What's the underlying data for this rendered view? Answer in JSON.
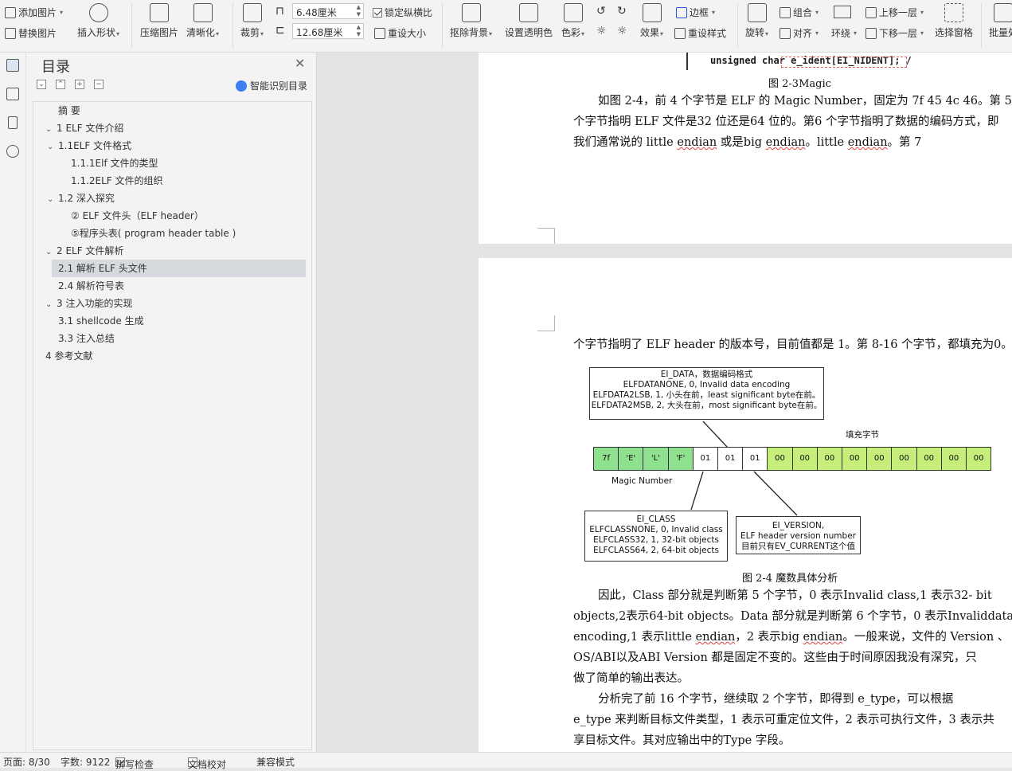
{
  "ribbon": {
    "add_image": "添加图片",
    "replace_image": "替换图片",
    "insert_shape": "插入形状",
    "compress_image": "压缩图片",
    "sharpen": "清晰化",
    "crop": "裁剪",
    "width_value": "6.48厘米",
    "height_value": "12.68厘米",
    "lock_ratio": "锁定纵横比",
    "reset_size": "重设大小",
    "remove_bg": "抠除背景",
    "set_transparent": "设置透明色",
    "color": "色彩",
    "effects": "效果",
    "border": "边框",
    "reset_style": "重设样式",
    "rotate": "旋转",
    "group": "组合",
    "align": "对齐",
    "wrap": "环绕",
    "bring_forward": "上移一层",
    "send_backward": "下移一层",
    "selection_pane": "选择窗格",
    "batch": "批量处"
  },
  "toc": {
    "title": "目录",
    "smart_label": "智能识别目录",
    "items": [
      {
        "label": "摘  要",
        "toggle": ""
      },
      {
        "label": "1 ELF 文件介绍",
        "toggle": "v"
      },
      {
        "label": "1.1ELF 文件格式",
        "toggle": "v"
      },
      {
        "label": "1.1.1Elf 文件的类型",
        "toggle": ""
      },
      {
        "label": "1.1.2ELF 文件的组织",
        "toggle": ""
      },
      {
        "label": "1.2 深入探究",
        "toggle": "v"
      },
      {
        "label": "② ELF 文件头（ELF header）",
        "toggle": ""
      },
      {
        "label": "⑤程序头表( program header table )",
        "toggle": ""
      },
      {
        "label": "2 ELF 文件解析",
        "toggle": "v"
      },
      {
        "label": "2.1 解析 ELF 头文件",
        "toggle": ""
      },
      {
        "label": "2.4 解析符号表",
        "toggle": ""
      },
      {
        "label": "3 注入功能的实现",
        "toggle": "v"
      },
      {
        "label": "3.1 shellcode 生成",
        "toggle": ""
      },
      {
        "label": "3.3 注入总结",
        "toggle": ""
      },
      {
        "label": "4 参考文献",
        "toggle": ""
      }
    ]
  },
  "doc": {
    "code_line": {
      "kw": "unsigned char",
      "rest": " e_ident[EI_NIDENT]; /"
    },
    "fig23": "图 2-3Magic",
    "p1_l1": "如图 2-4，前 4 个字节是 ELF 的 Magic Number，固定为 7f 45 4c 46。第 5",
    "p1_l2": "个字节指明 ELF 文件是32 位还是64 位的。第6 个字节指明了数据的编码方式，即",
    "p1_l3a": "我们通常说的 little ",
    "p1_l3b": "endian",
    "p1_l3c": " 或是big ",
    "p1_l3d": "endian",
    "p1_l3e": "。little ",
    "p1_l3f": "endian",
    "p1_l3g": "。第 7",
    "p2_l1": "个字节指明了 ELF header 的版本号，目前值都是 1。第 8-16 个字节，都填充为0。",
    "fig24": "图 2-4 魔数具体分析",
    "p3_l1": "因此，Class 部分就是判断第 5 个字节，0 表示Invalid class,1 表示32- bit",
    "p3_l2": "objects,2表示64-bit objects。Data 部分就是判断第 6 个字节，0 表示Invaliddata",
    "p3_l3a": "encoding,1 表示little ",
    "p3_l3b": "endian",
    "p3_l3c": "，2 表示big ",
    "p3_l3d": "endian",
    "p3_l3e": "。一般来说，文件的 Version 、",
    "p3_l4": "OS/ABI以及ABI Version 都是固定不变的。这些由于时间原因我没有深究，只",
    "p3_l5": "做了简单的输出表达。",
    "p4_l1": "分析完了前 16 个字节，继续取 2 个字节，即得到 e_type，可以根据",
    "p4_l2": "e_type 来判断目标文件类型，1 表示可重定位文件，2 表示可执行文件，3 表示共",
    "p4_l3": "享目标文件。其对应输出中的Type 字段。"
  },
  "diagram": {
    "data_box": [
      "EI_DATA，数据编码格式",
      "ELFDATANONE, 0, Invalid data encoding",
      "ELFDATA2LSB, 1, 小头在前，least significant byte在前。",
      "ELFDATA2MSB, 2, 大头在前，most significant byte在前。"
    ],
    "pad_label": "填充字节",
    "magic_label": "Magic Number",
    "cells": [
      "7f",
      "'E'",
      "'L'",
      "'F'",
      "01",
      "01",
      "01",
      "00",
      "00",
      "00",
      "00",
      "00",
      "00",
      "00",
      "00",
      "00"
    ],
    "class_box": [
      "EI_CLASS",
      "ELFCLASSNONE, 0, Invalid class",
      "ELFCLASS32, 1, 32-bit objects",
      "ELFCLASS64, 2, 64-bit objects"
    ],
    "version_box": [
      "EI_VERSION,",
      "ELF header version number",
      "目前只有EV_CURRENT这个值"
    ],
    "colors": {
      "magic": "#8fe08f",
      "pad": "#c6ee7a",
      "plain": "#ffffff"
    }
  },
  "status": {
    "page": "页面: 8/30",
    "words": "字数: 9122",
    "spell": "拼写检查",
    "proof": "文档校对",
    "compat": "兼容模式"
  }
}
